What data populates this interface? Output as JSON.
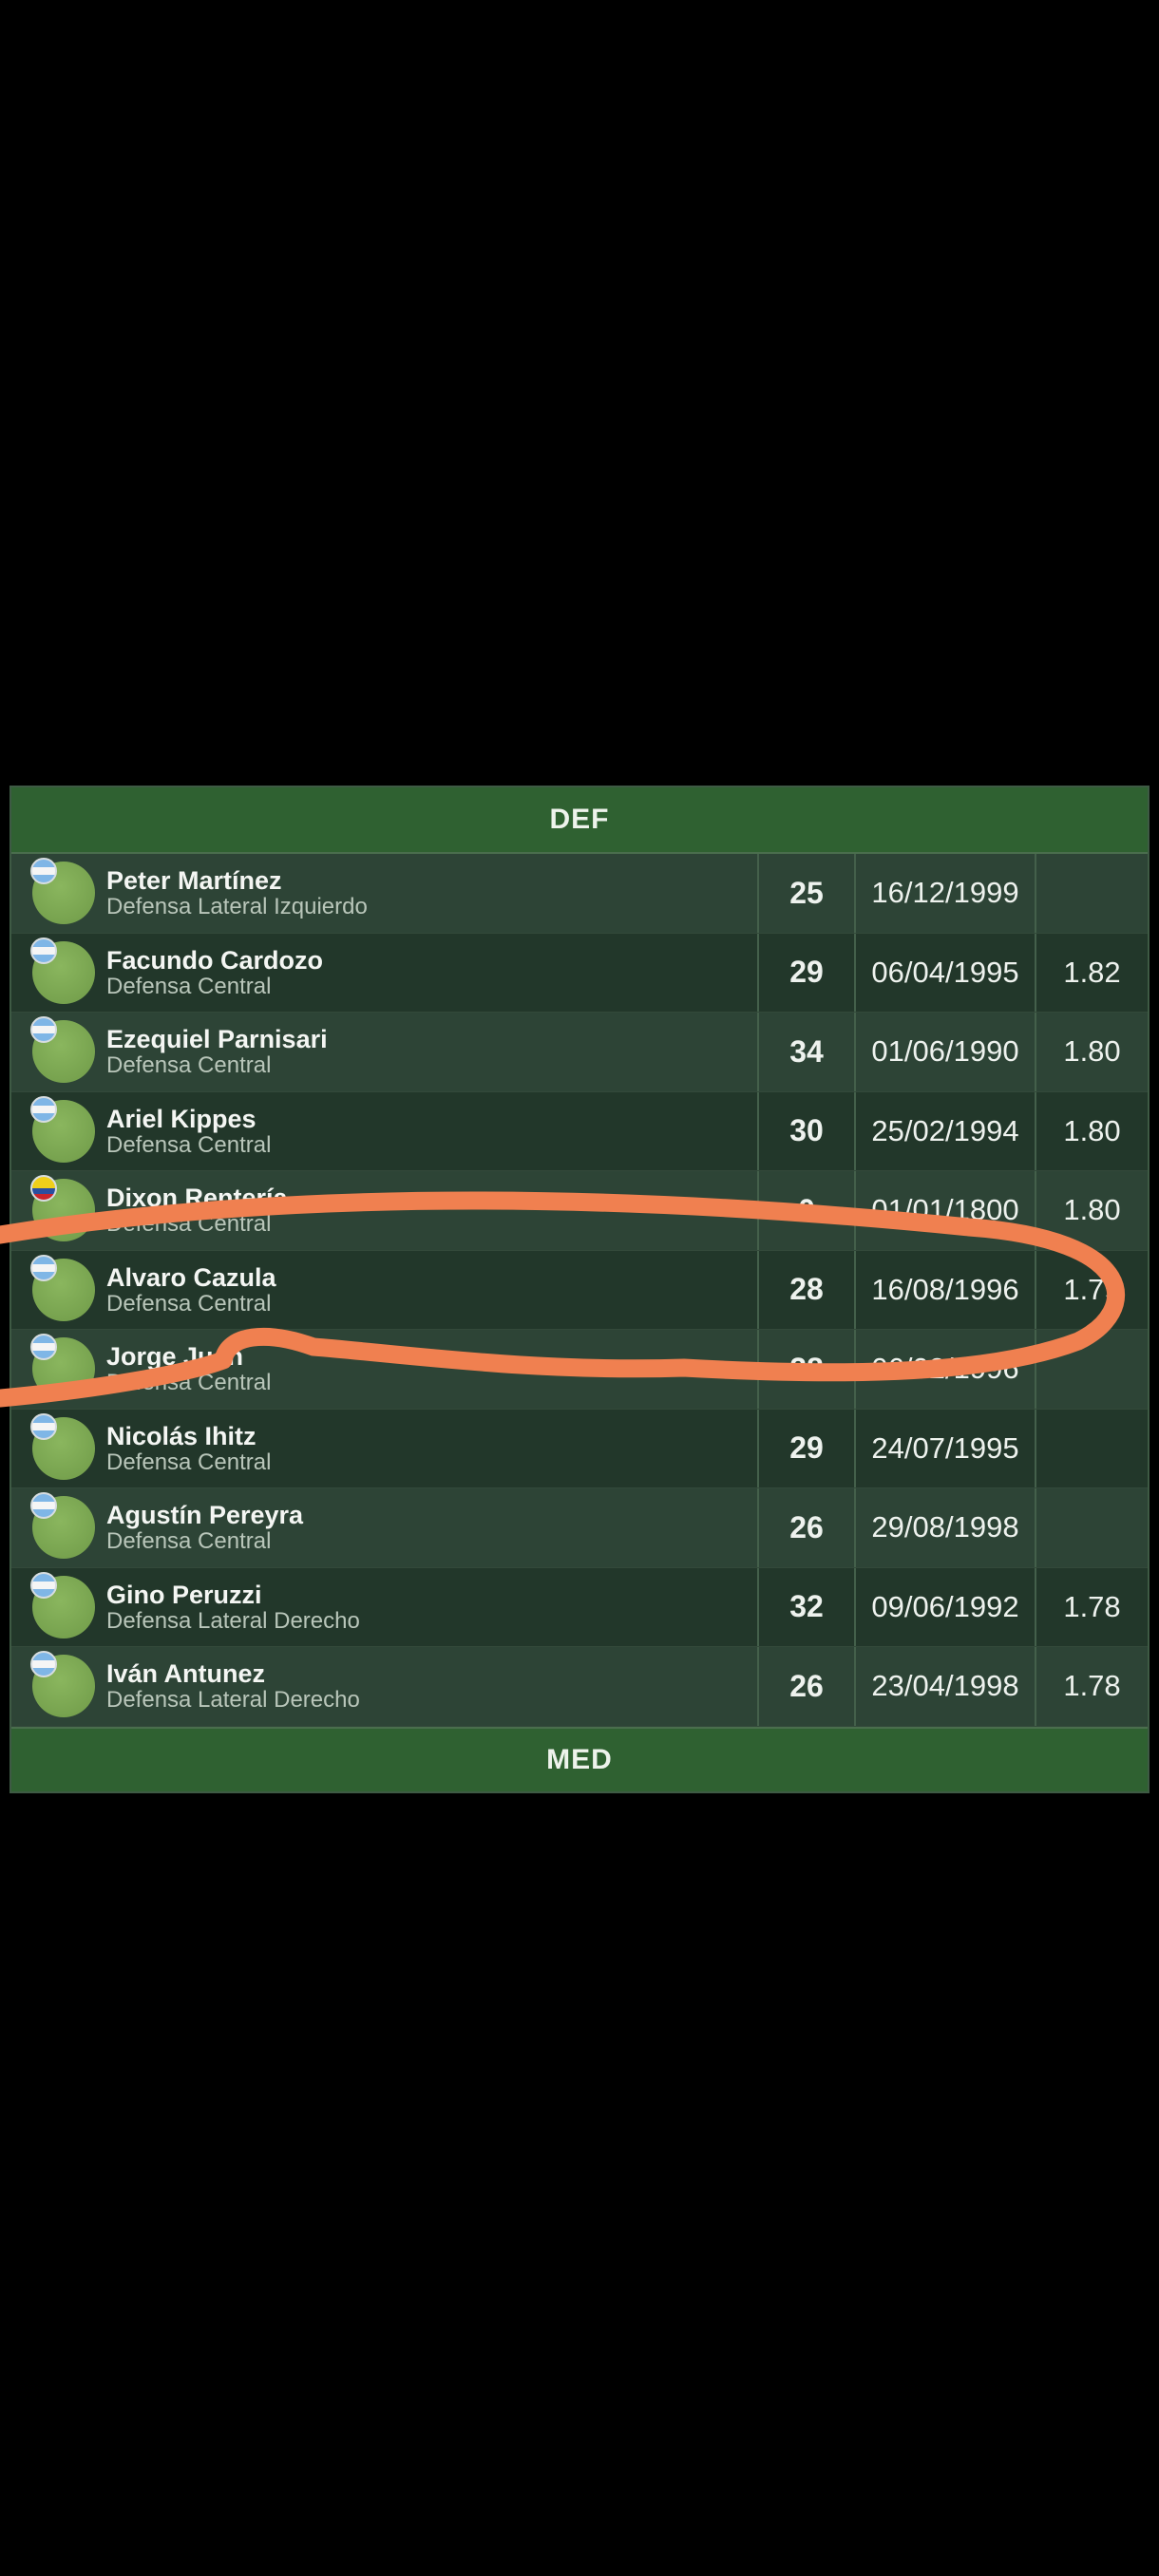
{
  "sections": {
    "def_title": "DEF",
    "med_title": "MED"
  },
  "players": [
    {
      "name": "Peter Martínez",
      "position": "Defensa Lateral Izquierdo",
      "age": "25",
      "dob": "16/12/1999",
      "height": "",
      "flag_icon": "argentina-flag-icon"
    },
    {
      "name": "Facundo Cardozo",
      "position": "Defensa Central",
      "age": "29",
      "dob": "06/04/1995",
      "height": "1.82",
      "flag_icon": "argentina-flag-icon"
    },
    {
      "name": "Ezequiel Parnisari",
      "position": "Defensa Central",
      "age": "34",
      "dob": "01/06/1990",
      "height": "1.80",
      "flag_icon": "argentina-flag-icon"
    },
    {
      "name": "Ariel Kippes",
      "position": "Defensa Central",
      "age": "30",
      "dob": "25/02/1994",
      "height": "1.80",
      "flag_icon": "argentina-flag-icon"
    },
    {
      "name": "Dixon Rentería",
      "position": "Defensa Central",
      "age": "0",
      "dob": "01/01/1800",
      "height": "1.80",
      "flag_icon": "colombia-flag-icon"
    },
    {
      "name": "Alvaro Cazula",
      "position": "Defensa Central",
      "age": "28",
      "dob": "16/08/1996",
      "height": "1.79",
      "flag_icon": "argentina-flag-icon"
    },
    {
      "name": "Jorge Juan",
      "position": "Defensa Central",
      "age": "28",
      "dob": "06/02/1996",
      "height": "",
      "flag_icon": "argentina-flag-icon"
    },
    {
      "name": "Nicolás Ihitz",
      "position": "Defensa Central",
      "age": "29",
      "dob": "24/07/1995",
      "height": "",
      "flag_icon": "argentina-flag-icon"
    },
    {
      "name": "Agustín Pereyra",
      "position": "Defensa Central",
      "age": "26",
      "dob": "29/08/1998",
      "height": "",
      "flag_icon": "argentina-flag-icon"
    },
    {
      "name": "Gino Peruzzi",
      "position": "Defensa Lateral Derecho",
      "age": "32",
      "dob": "09/06/1992",
      "height": "1.78",
      "flag_icon": "argentina-flag-icon"
    },
    {
      "name": "Iván Antunez",
      "position": "Defensa Lateral Derecho",
      "age": "26",
      "dob": "23/04/1998",
      "height": "1.78",
      "flag_icon": "argentina-flag-icon"
    }
  ],
  "colors": {
    "header_bg": "#2f6131",
    "row_dark": "#22372a",
    "row_light": "#2d4436",
    "scribble": "#f08050"
  }
}
